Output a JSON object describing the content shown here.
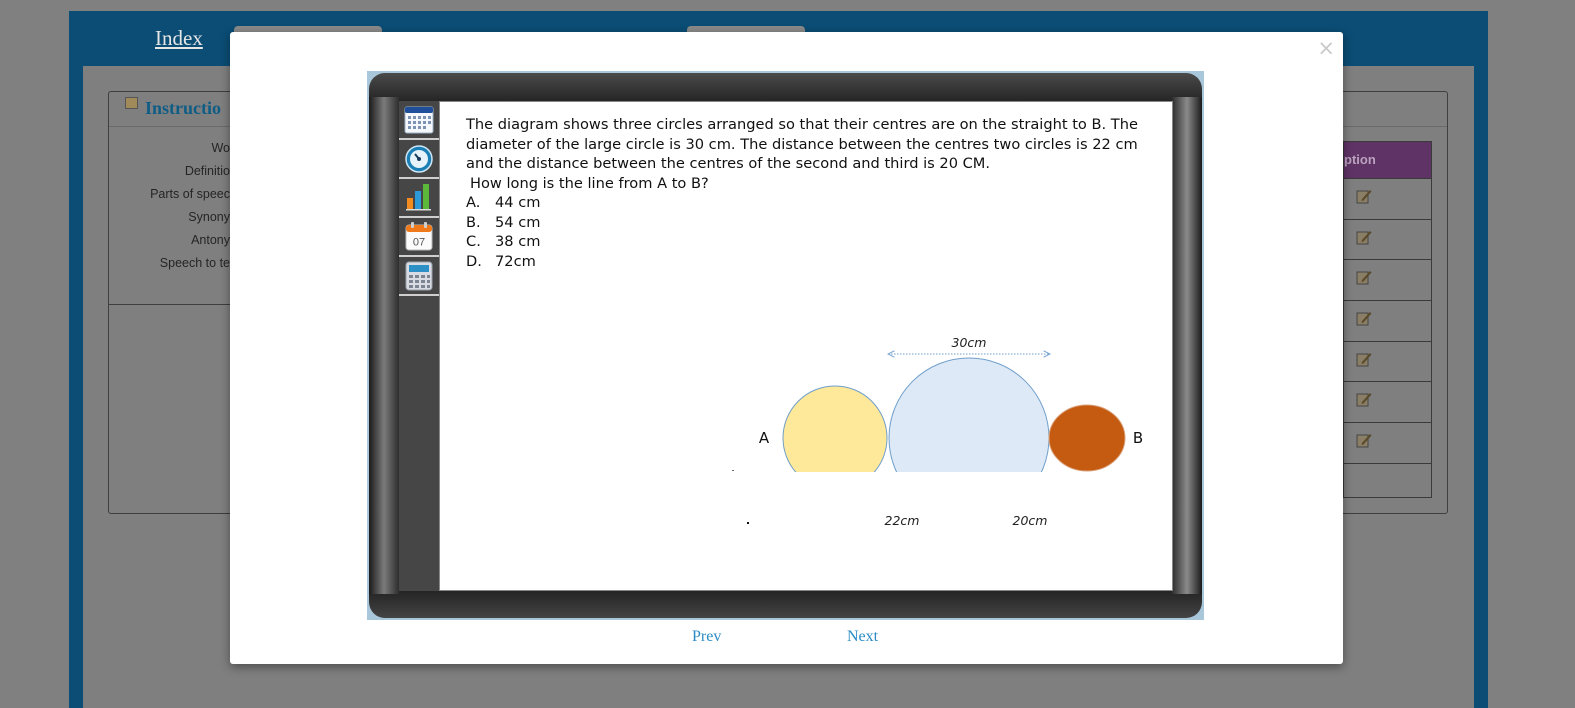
{
  "background": {
    "index_link": "Index",
    "instructions_title": "Instructio",
    "left_labels": [
      "Wo",
      "Definitio",
      "Parts of speec",
      "Synony",
      "Antony",
      "Speech to te"
    ],
    "option_header": "ption"
  },
  "modal": {
    "close_glyph": "×",
    "question": {
      "text": "The diagram shows three circles arranged so that their centres are on the straight to B. The diameter of the large circle is 30 cm. The distance between the centres two circles is 22 cm and the distance between the centres of the second and third is 20 CM.",
      "ask": "How long is the line from A to B?",
      "options": [
        {
          "letter": "A.",
          "value": "44 cm"
        },
        {
          "letter": "B.",
          "value": "54 cm"
        },
        {
          "letter": "C.",
          "value": "38 cm"
        },
        {
          "letter": "D.",
          "value": "72cm"
        }
      ]
    },
    "diagram": {
      "label_a": "A",
      "label_b": "B",
      "top_measure": "30cm",
      "left_measure": "22cm",
      "right_measure": "20cm",
      "colors": {
        "small_circle": "#fee89a",
        "large_circle": "#dde9f6",
        "right_circle": "#c55a11",
        "outline": "#6f9fcb"
      }
    },
    "sidebar_icons": [
      "calendar-grid-icon",
      "gauge-icon",
      "bar-chart-icon",
      "date-07-icon",
      "calculator-icon"
    ],
    "calendar_day": "07",
    "nav": {
      "prev": "Prev",
      "next": "Next"
    }
  }
}
